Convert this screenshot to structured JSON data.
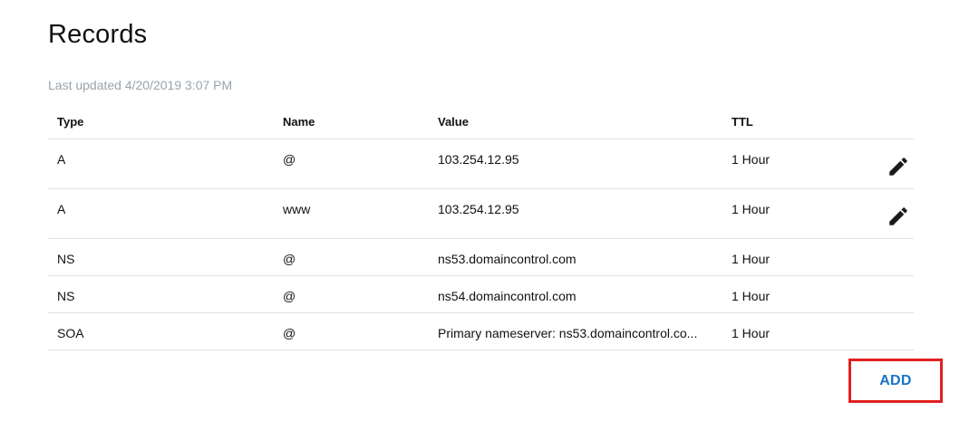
{
  "header": {
    "title": "Records",
    "last_updated": "Last updated 4/20/2019 3:07 PM"
  },
  "table": {
    "columns": [
      "Type",
      "Name",
      "Value",
      "TTL"
    ],
    "rows": [
      {
        "type": "A",
        "name": "@",
        "value": "103.254.12.95",
        "ttl": "1 Hour",
        "editable": true
      },
      {
        "type": "A",
        "name": "www",
        "value": "103.254.12.95",
        "ttl": "1 Hour",
        "editable": true
      },
      {
        "type": "NS",
        "name": "@",
        "value": "ns53.domaincontrol.com",
        "ttl": "1 Hour",
        "editable": false
      },
      {
        "type": "NS",
        "name": "@",
        "value": "ns54.domaincontrol.com",
        "ttl": "1 Hour",
        "editable": false
      },
      {
        "type": "SOA",
        "name": "@",
        "value": "Primary nameserver: ns53.domaincontrol.co...",
        "ttl": "1 Hour",
        "editable": false
      }
    ],
    "edit_icon": "pencil-icon"
  },
  "actions": {
    "add_label": "ADD",
    "highlight_color": "#e02020",
    "link_color": "#1a73c8"
  }
}
